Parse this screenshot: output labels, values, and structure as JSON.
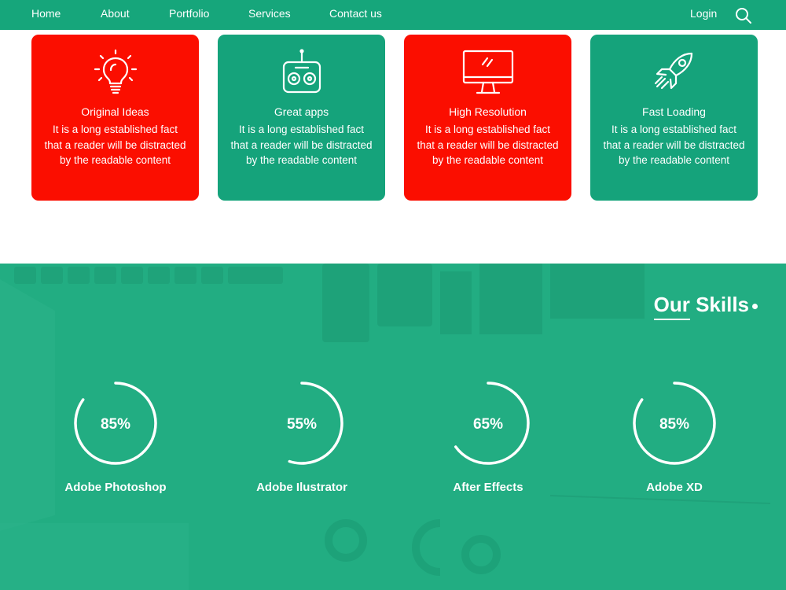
{
  "nav": {
    "items": [
      "Home",
      "About",
      "Portfolio",
      "Services",
      "Contact us"
    ],
    "login": "Login",
    "search_icon": "search-icon"
  },
  "features": [
    {
      "icon": "lightbulb-icon",
      "title": "Original Ideas",
      "description": "It is a long established fact that a reader will be distracted by the readable content",
      "color": "#fb0e00"
    },
    {
      "icon": "remote-control-icon",
      "title": "Great apps",
      "description": "It is a long established fact that a reader will be distracted by the readable content",
      "color": "#15a37b"
    },
    {
      "icon": "monitor-icon",
      "title": "High Resolution",
      "description": "It is a long established fact that a reader will be distracted by the readable content",
      "color": "#fb0e00"
    },
    {
      "icon": "rocket-icon",
      "title": "Fast Loading",
      "description": "It is a long established fact that a reader will be distracted by the readable content",
      "color": "#15a37b"
    }
  ],
  "skills": {
    "heading_underlined": "Our",
    "heading_rest": " Skills",
    "items": [
      {
        "name": "Adobe Photoshop",
        "percent_label": "85%",
        "percent": 85
      },
      {
        "name": "Adobe Ilustrator",
        "percent_label": "55%",
        "percent": 55
      },
      {
        "name": "After Effects",
        "percent_label": "65%",
        "percent": 65
      },
      {
        "name": "Adobe XD",
        "percent_label": "85%",
        "percent": 85
      }
    ]
  },
  "colors": {
    "brand_green": "#16a67b",
    "card_red": "#fb0e00",
    "card_green": "#15a37b",
    "section_green": "#22ad82"
  }
}
